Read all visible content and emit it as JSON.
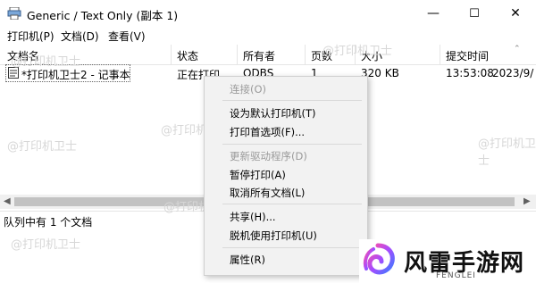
{
  "window": {
    "title": "Generic / Text Only (副本 1)",
    "controls": {
      "minimize": "—",
      "maximize": "☐",
      "close": "✕"
    }
  },
  "menubar": {
    "items": [
      "打印机(P)",
      "文档(D)",
      "查看(V)"
    ]
  },
  "columns": [
    "文档名",
    "状态",
    "所有者",
    "页数",
    "大小",
    "提交时间"
  ],
  "rows": [
    {
      "name": "*打印机卫士2 - 记事本",
      "status": "正在打印",
      "owner": "ODBS",
      "pages": "1",
      "size": "320 KB",
      "time": "13:53:08",
      "date": "2023/9/"
    }
  ],
  "statusbar": {
    "text": "队列中有 1 个文档"
  },
  "context_menu": {
    "items": [
      {
        "label": "连接(O)",
        "disabled": true
      },
      {
        "label": "设为默认打印机(T)",
        "disabled": false
      },
      {
        "label": "打印首选项(F)...",
        "disabled": false
      },
      {
        "label": "更新驱动程序(D)",
        "disabled": true
      },
      {
        "label": "暂停打印(A)",
        "disabled": false
      },
      {
        "label": "取消所有文档(L)",
        "disabled": false
      },
      {
        "label": "共享(H)...",
        "disabled": false
      },
      {
        "label": "脱机使用打印机(U)",
        "disabled": false
      },
      {
        "label": "属性(R)",
        "disabled": false
      }
    ]
  },
  "watermark": {
    "text": "@打印机卫士"
  },
  "logo": {
    "cn": "风雷手游网",
    "en": "FENGLEI"
  },
  "colors": {
    "separator": "#e5e5e5",
    "menu_bg": "#f2f2f2",
    "disabled": "#9a9a9a"
  }
}
